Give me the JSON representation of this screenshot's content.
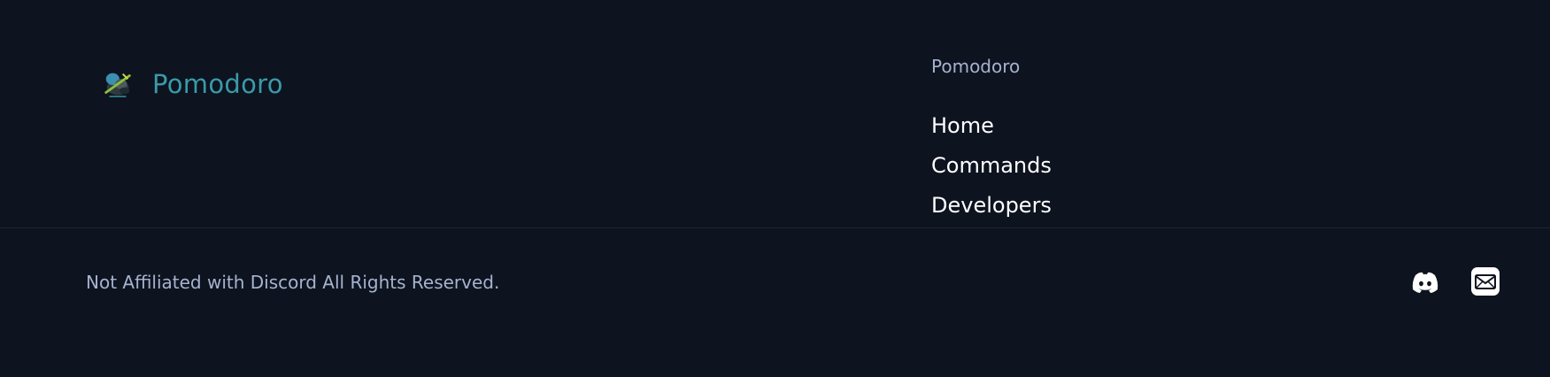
{
  "brand": {
    "name": "Pomodoro",
    "logo_icon": "pomodoro-logo-icon",
    "name_color": "#3a9aa8"
  },
  "nav": {
    "heading": "Pomodoro",
    "links": [
      {
        "label": "Home"
      },
      {
        "label": "Commands"
      },
      {
        "label": "Developers"
      }
    ]
  },
  "footer": {
    "copyright": "Not Affiliated with Discord All Rights Reserved.",
    "social": [
      {
        "icon": "discord-icon"
      },
      {
        "icon": "mail-icon"
      }
    ]
  },
  "colors": {
    "background": "#0d131f",
    "muted_text": "#a6b3cf",
    "link_text": "#ffffff"
  }
}
